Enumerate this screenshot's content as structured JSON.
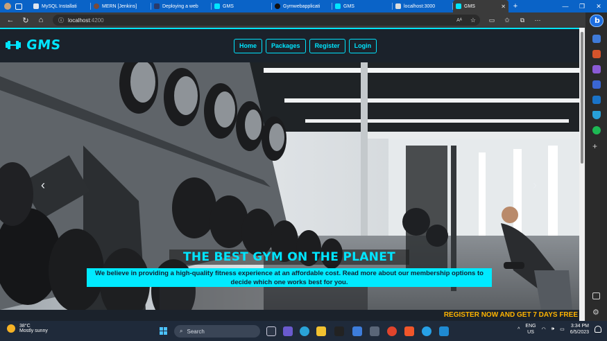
{
  "browser": {
    "tabs": [
      {
        "label": "MySQL Installati",
        "favicon_color": "#e0e6ee"
      },
      {
        "label": "MERN [Jenkins]",
        "favicon_color": "#7a4a3a"
      },
      {
        "label": "Deploying a web",
        "favicon_color": "#2a3a6a"
      },
      {
        "label": "GMS",
        "favicon_color": "#00e5ff"
      },
      {
        "label": "Gymwebapplicati",
        "favicon_color": "#111111"
      },
      {
        "label": "GMS",
        "favicon_color": "#00e5ff"
      },
      {
        "label": "localhost:3000",
        "favicon_color": "#dddddd"
      },
      {
        "label": "GMS",
        "favicon_color": "#00e5ff",
        "active": true
      }
    ],
    "url_host": "localhost",
    "url_port": ":4200",
    "reader_icon": "Aᴬ"
  },
  "site": {
    "brand": "GMS",
    "nav": [
      "Home",
      "Packages",
      "Register",
      "Login"
    ],
    "hero_title": "THE BEST GYM ON THE PLANET",
    "hero_text": "We believe in providing a high-quality fitness experience at an affordable cost. Read more about our membership options to decide which one works best for you.",
    "promo": "REGISTER NOW AND GET 7 DAYS FREE",
    "accent_color": "#00e5ff",
    "promo_color": "#ffb400"
  },
  "taskbar": {
    "temperature": "38°C",
    "weather": "Mostly sunny",
    "search_placeholder": "Search",
    "lang_1": "ENG",
    "lang_2": "US",
    "time": "3:34 PM",
    "date": "6/5/2023"
  }
}
